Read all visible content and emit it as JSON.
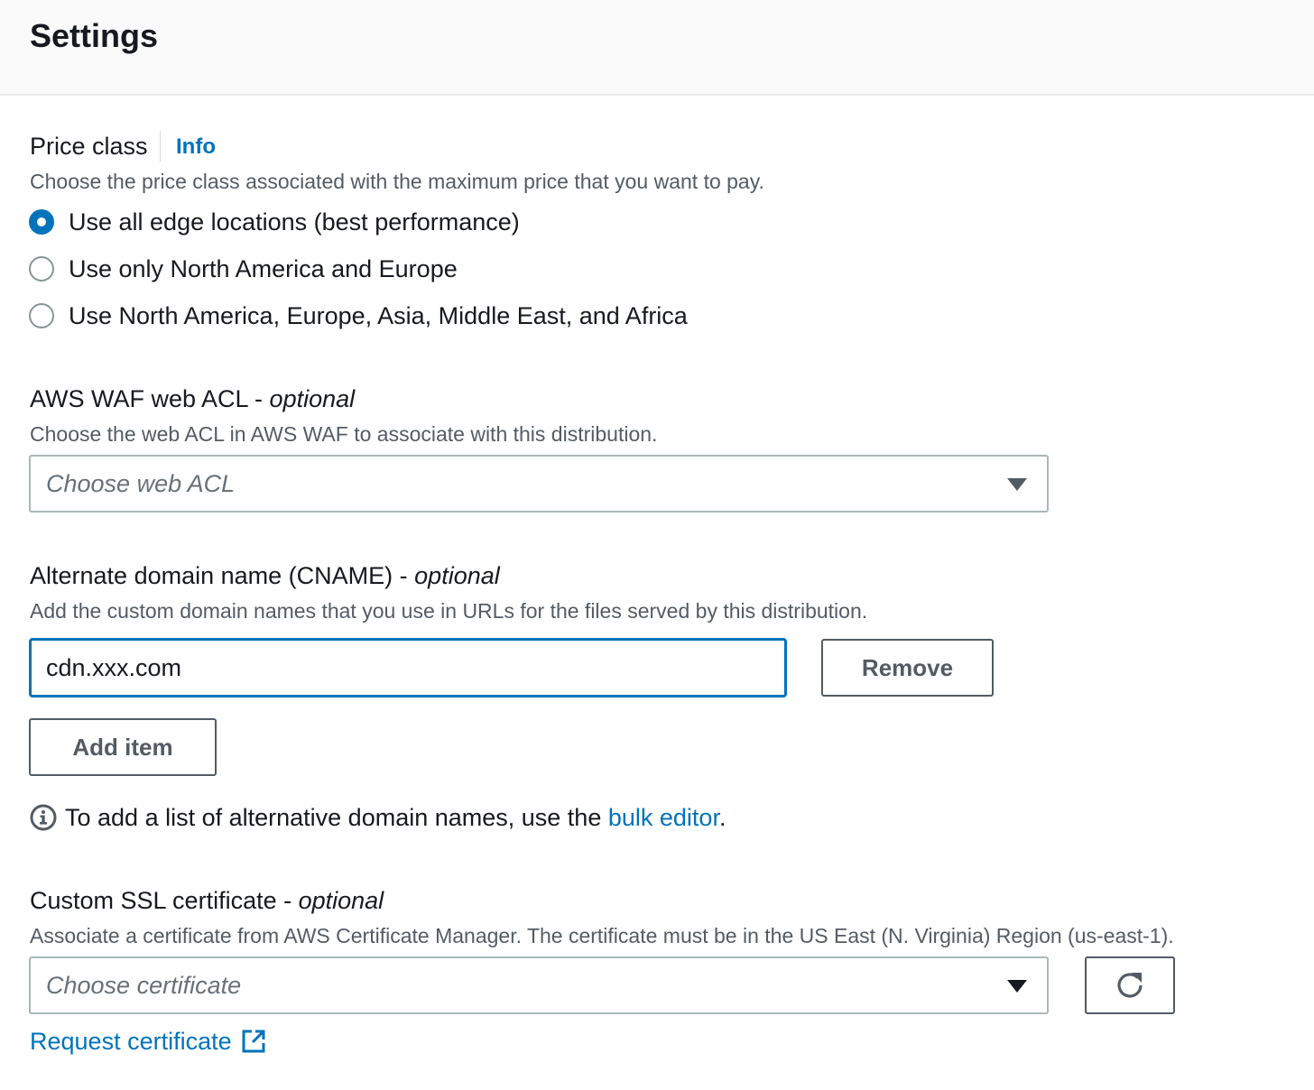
{
  "header": {
    "title": "Settings"
  },
  "price_class": {
    "label": "Price class",
    "info_link": "Info",
    "description": "Choose the price class associated with the maximum price that you want to pay.",
    "options": [
      {
        "label": "Use all edge locations (best performance)",
        "selected": true
      },
      {
        "label": "Use only North America and Europe",
        "selected": false
      },
      {
        "label": "Use North America, Europe, Asia, Middle East, and Africa",
        "selected": false
      }
    ]
  },
  "waf": {
    "label": "AWS WAF web ACL - ",
    "optional": "optional",
    "description": "Choose the web ACL in AWS WAF to associate with this distribution.",
    "placeholder": "Choose web ACL"
  },
  "cname": {
    "label": "Alternate domain name (CNAME) - ",
    "optional": "optional",
    "description": "Add the custom domain names that you use in URLs for the files served by this distribution.",
    "value": "cdn.xxx.com",
    "remove_label": "Remove",
    "add_item_label": "Add item",
    "note_prefix": "To add a list of alternative domain names, use the ",
    "note_link": "bulk editor",
    "note_suffix": "."
  },
  "ssl": {
    "label": "Custom SSL certificate - ",
    "optional": "optional",
    "description": "Associate a certificate from AWS Certificate Manager. The certificate must be in the US East (N. Virginia) Region (us-east-1).",
    "placeholder": "Choose certificate",
    "request_link": "Request certificate"
  },
  "colors": {
    "accent": "#0073bb",
    "text": "#16191f",
    "muted": "#545b64",
    "border": "#aab7b8"
  }
}
